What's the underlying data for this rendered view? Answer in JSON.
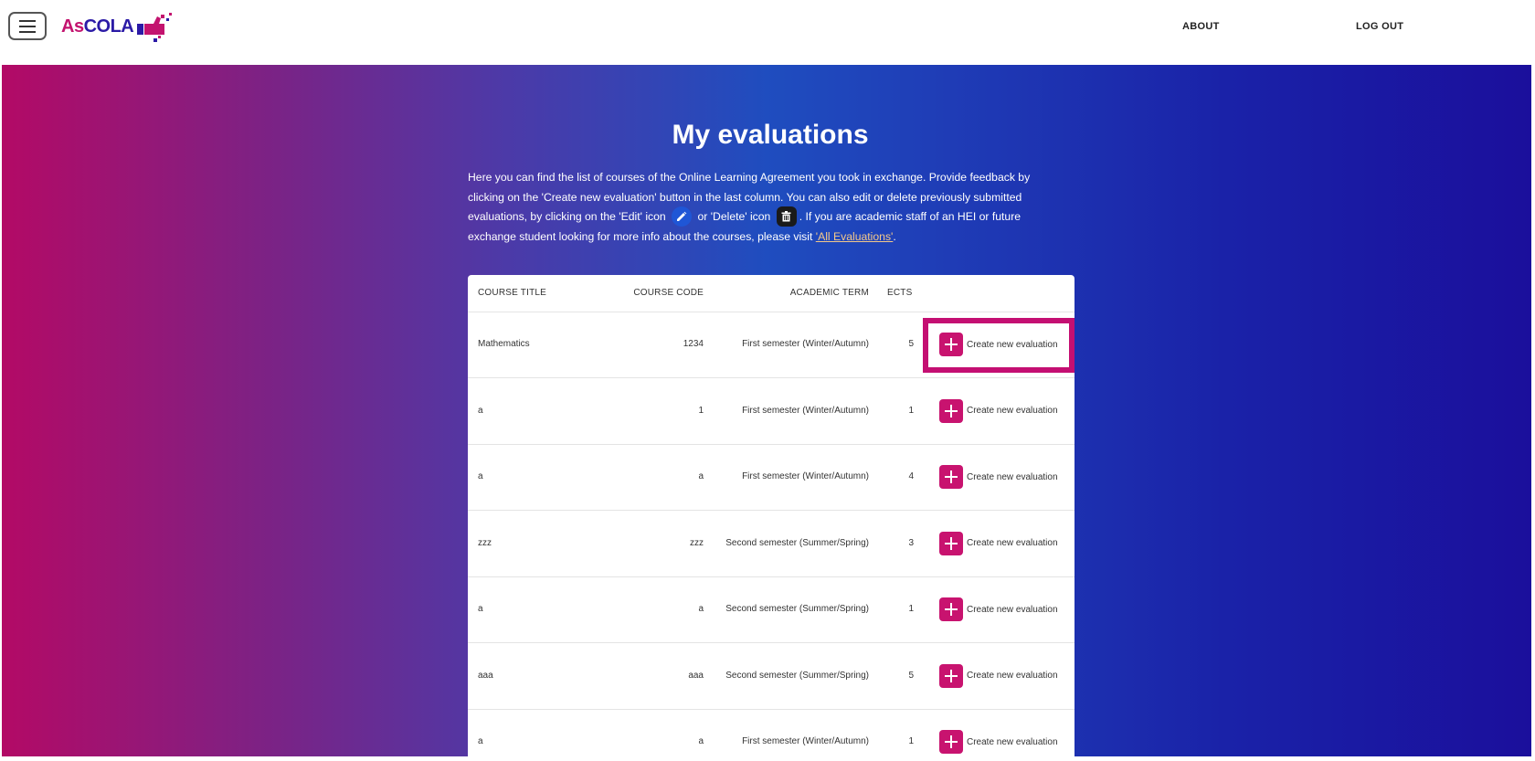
{
  "header": {
    "logo_text_as": "As",
    "logo_text_cola": "COLA",
    "nav": {
      "about": "ABOUT",
      "logout": "LOG OUT"
    }
  },
  "main": {
    "title": "My evaluations",
    "intro": {
      "part1": "Here you can find the list of courses of the Online Learning Agreement you took in exchange. Provide feedback by clicking on the 'Create new evaluation' button in the last column. You can also edit or delete previously submitted evaluations, by clicking on the 'Edit' icon",
      "part2": "or 'Delete' icon",
      "part3": ". If you are academic staff of an HEI or future exchange student looking for more info about the courses, please visit",
      "link": "'All Evaluations'",
      "part4": "."
    }
  },
  "table": {
    "columns": {
      "title": "COURSE TITLE",
      "code": "COURSE CODE",
      "term": "ACADEMIC TERM",
      "ects": "ECTS"
    },
    "action_label": "Create new evaluation",
    "rows": [
      {
        "title": "Mathematics",
        "code": "1234",
        "term": "First semester (Winter/Autumn)",
        "ects": "5"
      },
      {
        "title": "a",
        "code": "1",
        "term": "First semester (Winter/Autumn)",
        "ects": "1"
      },
      {
        "title": "a",
        "code": "a",
        "term": "First semester (Winter/Autumn)",
        "ects": "4"
      },
      {
        "title": "zzz",
        "code": "zzz",
        "term": "Second semester (Summer/Spring)",
        "ects": "3"
      },
      {
        "title": "a",
        "code": "a",
        "term": "Second semester (Summer/Spring)",
        "ects": "1"
      },
      {
        "title": "aaa",
        "code": "aaa",
        "term": "Second semester (Summer/Spring)",
        "ects": "5"
      },
      {
        "title": "a",
        "code": "a",
        "term": "First semester (Winter/Autumn)",
        "ects": "1"
      }
    ]
  },
  "colors": {
    "accent": "#c8136f",
    "brand_blue": "#2b1aa6",
    "edit_icon": "#1f56d6",
    "link": "#f3c88a"
  },
  "icons": {
    "menu": "hamburger-icon",
    "edit": "pencil-icon",
    "delete": "trash-icon",
    "create": "plus-icon"
  }
}
